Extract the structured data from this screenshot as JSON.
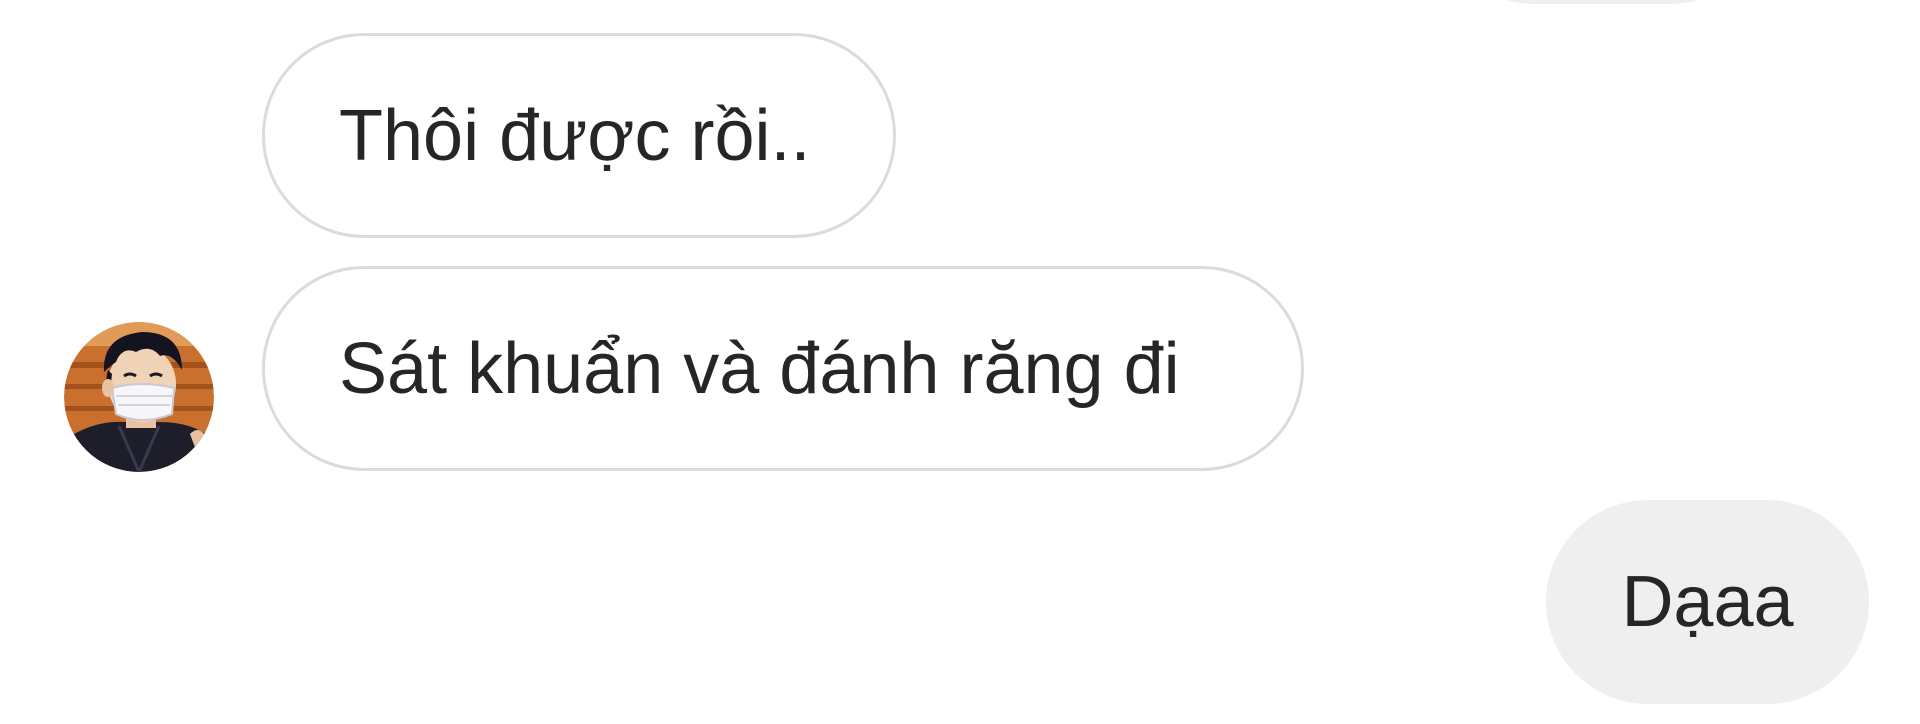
{
  "conversation": {
    "messages": [
      {
        "sender": "other",
        "text": "Thôi được rồi.."
      },
      {
        "sender": "other",
        "text": "Sát khuẩn và đánh răng đi"
      },
      {
        "sender": "me",
        "text": "Dạaa"
      }
    ]
  },
  "colors": {
    "received_bubble_bg": "#ffffff",
    "received_bubble_border": "#dbdbdb",
    "sent_bubble_bg": "#efefef",
    "text": "#262626"
  },
  "icons": {
    "avatar": "avatar-masked-person"
  }
}
